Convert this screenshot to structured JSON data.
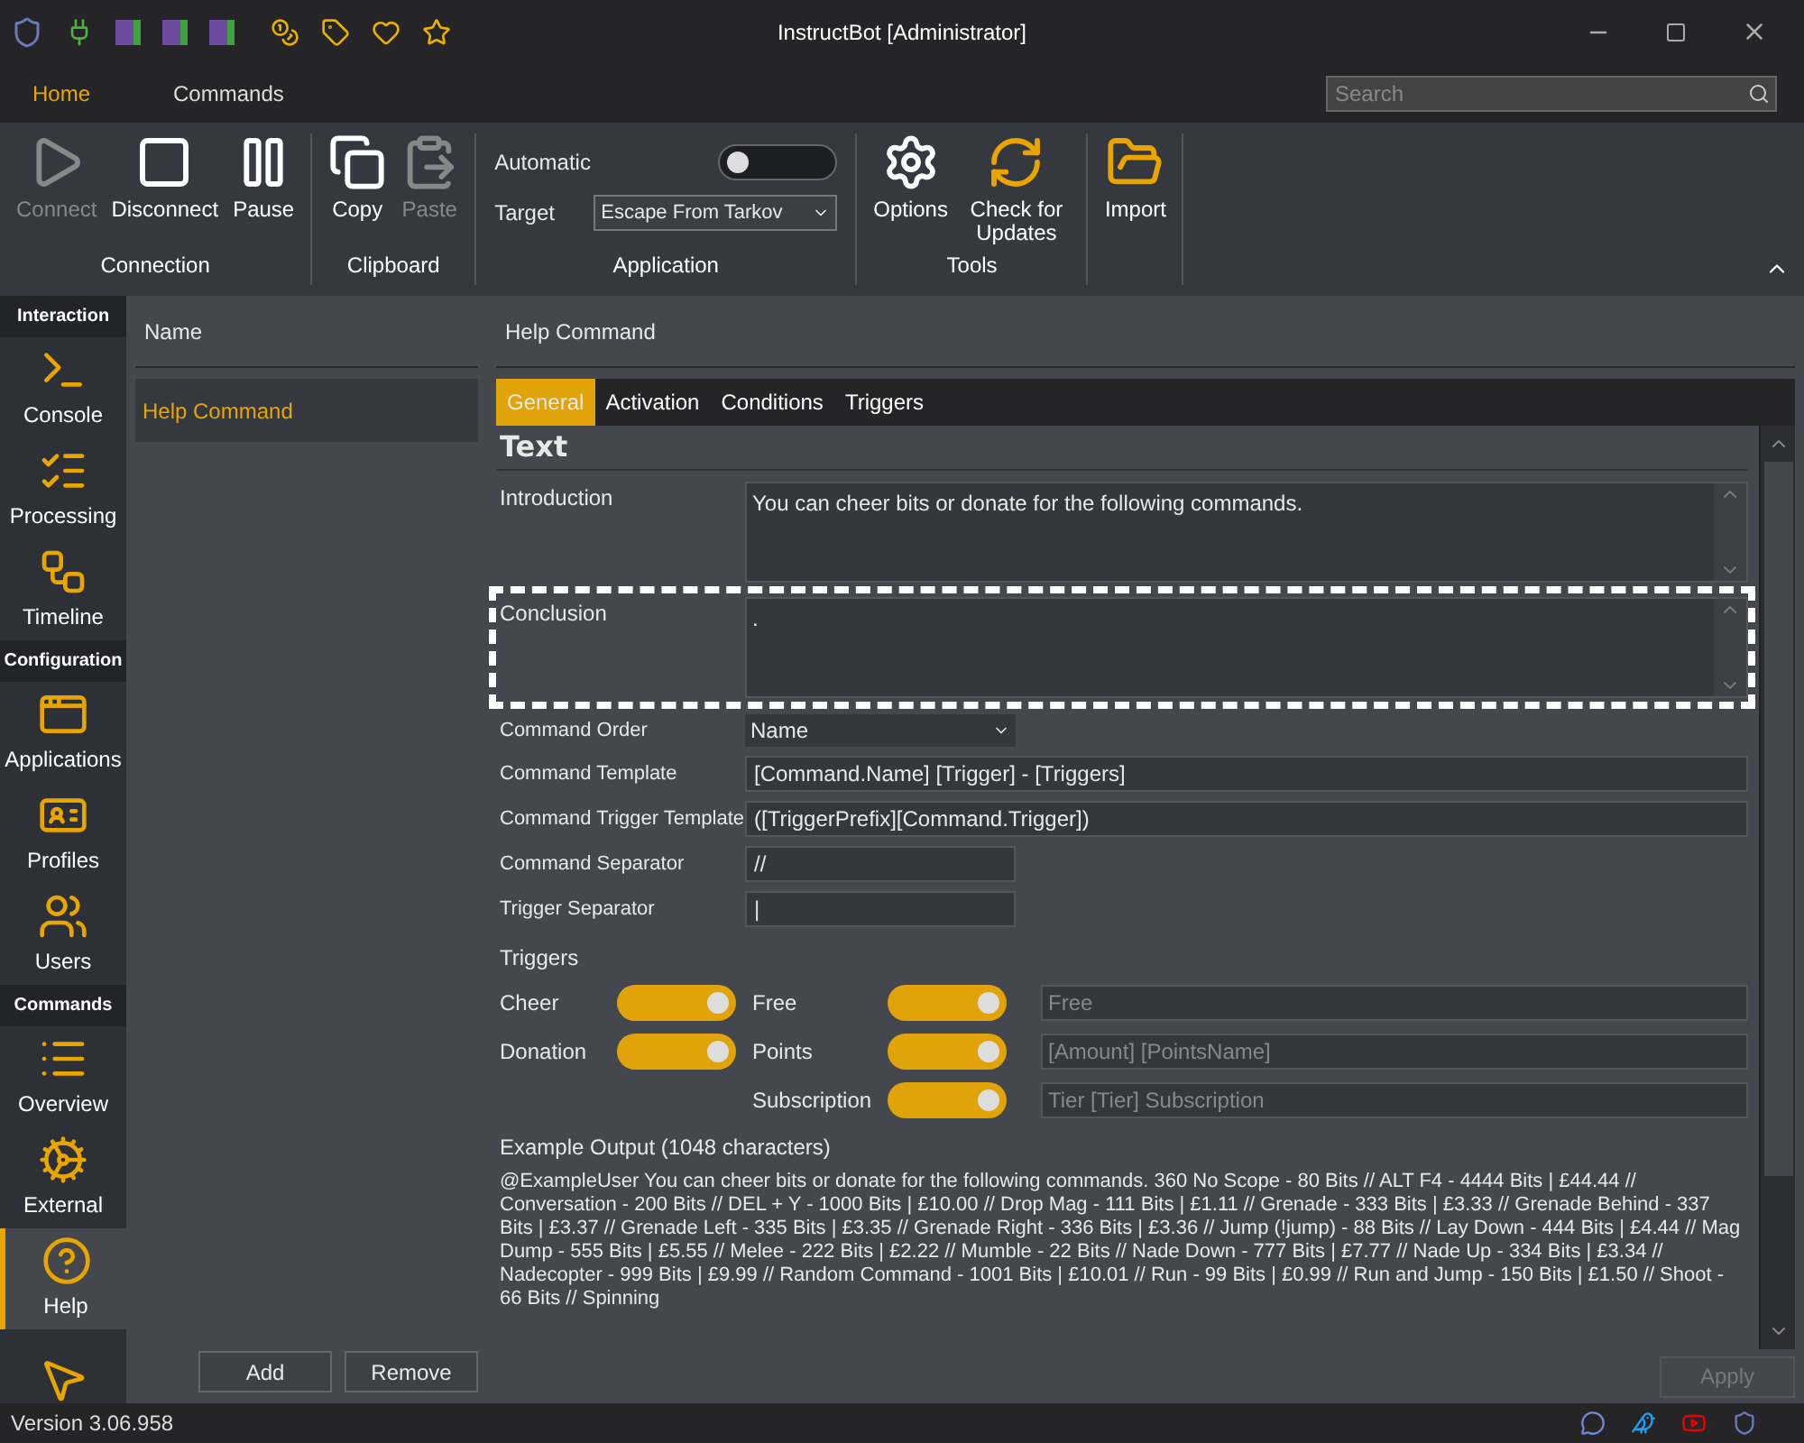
{
  "window": {
    "title": "InstructBot [Administrator]"
  },
  "ribbon_tabs": [
    {
      "label": "Home",
      "selected": true
    },
    {
      "label": "Commands",
      "selected": false
    }
  ],
  "search": {
    "placeholder": "Search"
  },
  "ribbon_groups": [
    {
      "label": "Connection",
      "buttons": [
        {
          "label": "Connect",
          "disabled": true
        },
        {
          "label": "Disconnect",
          "disabled": false
        },
        {
          "label": "Pause",
          "disabled": false
        }
      ]
    },
    {
      "label": "Clipboard",
      "buttons": [
        {
          "label": "Copy",
          "disabled": false
        },
        {
          "label": "Paste",
          "disabled": true
        }
      ]
    },
    {
      "label": "Application",
      "automatic": {
        "label": "Automatic",
        "on": false
      },
      "target": {
        "label": "Target",
        "value": "Escape From Tarkov"
      }
    },
    {
      "label": "Tools",
      "buttons": [
        {
          "label": "Options",
          "disabled": false
        },
        {
          "label": "Check for Updates",
          "disabled": false
        }
      ]
    },
    {
      "buttons": [
        {
          "label": "Import",
          "disabled": false
        }
      ]
    }
  ],
  "sidebar": [
    {
      "heading": "Interaction",
      "items": [
        {
          "label": "Console",
          "selected": false
        },
        {
          "label": "Processing",
          "selected": false
        },
        {
          "label": "Timeline",
          "selected": false
        }
      ]
    },
    {
      "heading": "Configuration",
      "items": [
        {
          "label": "Applications",
          "selected": false
        },
        {
          "label": "Profiles",
          "selected": false
        },
        {
          "label": "Users",
          "selected": false
        }
      ]
    },
    {
      "heading": "Commands",
      "items": [
        {
          "label": "Overview",
          "selected": false
        },
        {
          "label": "External",
          "selected": false
        },
        {
          "label": "Help",
          "selected": true
        },
        {
          "selected": false
        }
      ]
    }
  ],
  "command_list": {
    "column": "Name",
    "items": [
      {
        "label": "Help Command",
        "selected": true
      }
    ],
    "buttons": [
      "Add",
      "Remove"
    ]
  },
  "detail": {
    "title": "Help Command",
    "tabs": [
      {
        "label": "General",
        "selected": true
      },
      {
        "label": "Activation",
        "selected": false
      },
      {
        "label": "Conditions",
        "selected": false
      },
      {
        "label": "Triggers",
        "selected": false
      }
    ],
    "section": "Text",
    "introduction": {
      "label": "Introduction",
      "value": "You can cheer bits or donate for the following commands."
    },
    "conclusion": {
      "label": "Conclusion",
      "value": ".",
      "highlighted": true
    },
    "fields": [
      {
        "label": "Command Order",
        "value": "Name",
        "kind": "dropdown"
      },
      {
        "label": "Command Template",
        "value": "[Command.Name] [Trigger] - [Triggers]",
        "kind": "wide"
      },
      {
        "label": "Command Trigger Template",
        "value": "([TriggerPrefix][Command.Trigger])",
        "kind": "wide"
      },
      {
        "label": "Command Separator",
        "value": "//",
        "kind": "short"
      },
      {
        "label": "Trigger Separator",
        "value": "|",
        "kind": "short"
      }
    ],
    "triggers_label": "Triggers",
    "triggers": [
      {
        "label": "Cheer",
        "on": true
      },
      {
        "label": "Free",
        "on": true,
        "placeholder": "Free"
      },
      {
        "label": "Donation",
        "on": true
      },
      {
        "label": "Points",
        "on": true,
        "placeholder": "[Amount] [PointsName]"
      },
      {
        "label": "Subscription",
        "on": true,
        "placeholder": "Tier [Tier] Subscription"
      }
    ],
    "example_label": "Example Output (1048 characters)",
    "example_text": "@ExampleUser You can cheer bits or donate for the following commands. 360 No Scope  - 80 Bits // ALT F4  - 4444 Bits | £44.44 // Conversation  - 200 Bits // DEL + Y  - 1000 Bits | £10.00 // Drop Mag  - 111 Bits | £1.11 // Grenade  - 333 Bits | £3.33 // Grenade Behind  - 337 Bits | £3.37 // Grenade Left  - 335 Bits | £3.35 // Grenade Right  - 336 Bits | £3.36 // Jump  (!jump) - 88 Bits // Lay Down  - 444 Bits | £4.44 // Mag Dump  - 555 Bits | £5.55 // Melee  - 222 Bits | £2.22 // Mumble  - 22 Bits // Nade Down  - 777 Bits | £7.77 // Nade Up  - 334 Bits | £3.34 // Nadecopter  - 999 Bits | £9.99 // Random Command  - 1001 Bits | £10.01 // Run  - 99 Bits | £0.99 // Run and Jump  - 150 Bits | £1.50 // Shoot  - 66 Bits // Spinning",
    "apply": {
      "label": "Apply",
      "disabled": true
    }
  },
  "status_bar": {
    "version": "Version 3.06.958"
  }
}
